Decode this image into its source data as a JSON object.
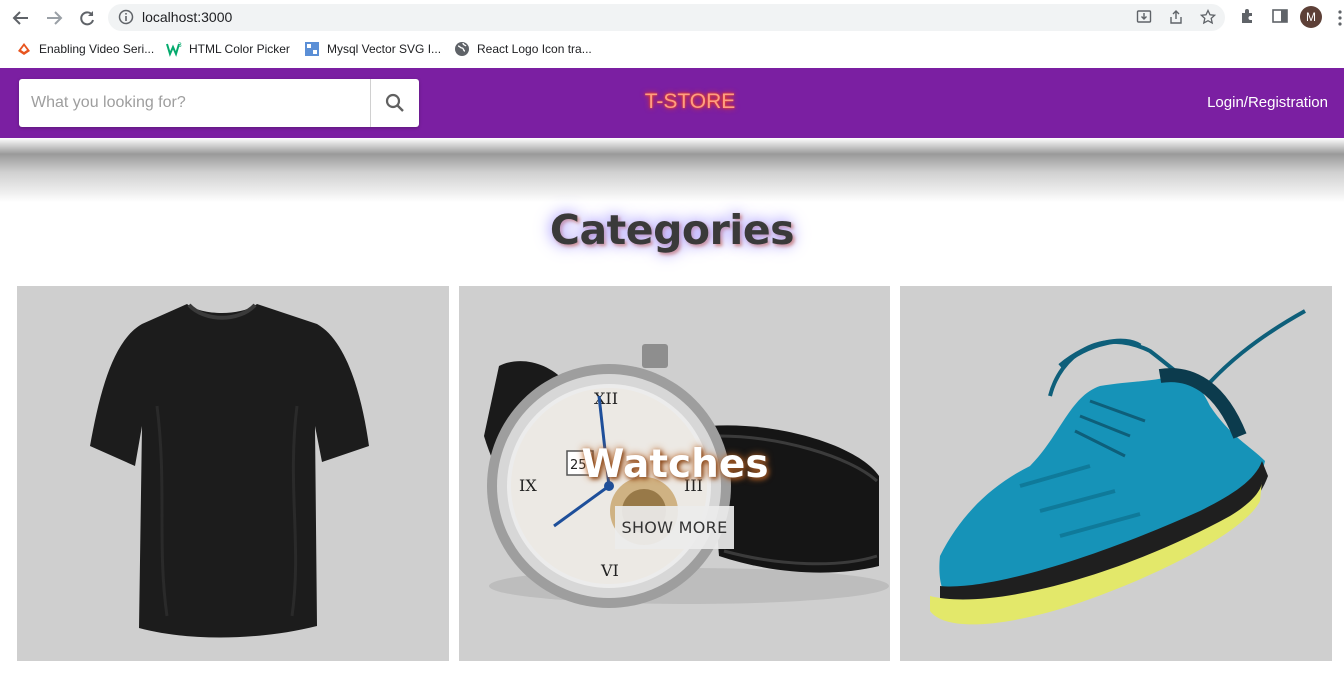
{
  "browser": {
    "url": "localhost:3000",
    "avatar_letter": "M",
    "bookmarks": [
      {
        "label": "Enabling Video Seri...",
        "icon": "tutorial-icon"
      },
      {
        "label": "HTML Color Picker",
        "icon": "w3schools-icon"
      },
      {
        "label": "Mysql Vector SVG I...",
        "icon": "svgrepo-icon"
      },
      {
        "label": "React Logo Icon tra...",
        "icon": "globe-icon"
      }
    ]
  },
  "header": {
    "search_placeholder": "What you looking for?",
    "brand": "T-STORE",
    "login_label": "Login/Registration",
    "bg_color": "#7b1fa2"
  },
  "main": {
    "categories_title": "Categories",
    "cards": [
      {
        "image": "black-tshirt",
        "title": "",
        "button": ""
      },
      {
        "image": "wristwatch",
        "title": "Watches",
        "button": "SHOW MORE"
      },
      {
        "image": "blue-sneaker",
        "title": "",
        "button": ""
      }
    ]
  }
}
